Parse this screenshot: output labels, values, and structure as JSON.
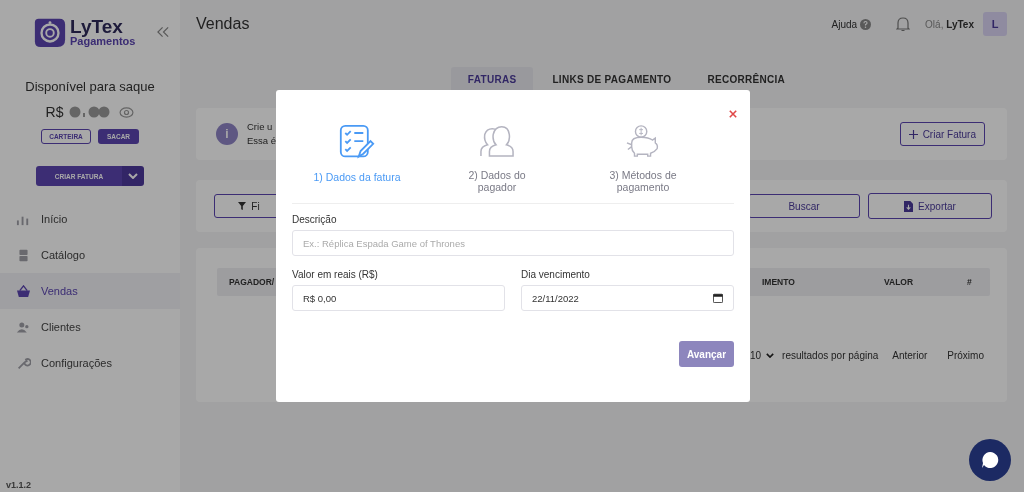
{
  "sidebar": {
    "logo": {
      "name": "LyTex",
      "subtitle": "Pagamentos"
    },
    "balance": {
      "title": "Disponível para saque",
      "currency": "R$"
    },
    "wallet_buttons": [
      "CARTEIRA",
      "SACAR"
    ],
    "create_button": "CRIAR FATURA",
    "items": [
      {
        "label": "Início",
        "kind": "chart",
        "selected": false
      },
      {
        "label": "Catálogo",
        "kind": "drawer",
        "selected": false
      },
      {
        "label": "Vendas",
        "kind": "basket",
        "selected": true
      },
      {
        "label": "Clientes",
        "kind": "users",
        "selected": false
      },
      {
        "label": "Configurações",
        "kind": "wrench",
        "selected": false
      }
    ],
    "version": "v1.1.2"
  },
  "header": {
    "title": "Vendas",
    "help": "Ajuda",
    "greeting": "Olá,",
    "user": "LyTex",
    "avatar": "L"
  },
  "tabs": [
    {
      "label": "FATURAS",
      "selected": true
    },
    {
      "label": "LINKS DE PAGAMENTO",
      "selected": false
    },
    {
      "label": "RECORRÊNCIA",
      "selected": false
    }
  ],
  "info": {
    "icon": "i",
    "lines": [
      "Crie u",
      "Essa é"
    ],
    "button": "Criar Fatura"
  },
  "filters": {
    "filter_button": "Fi",
    "search_button": "Buscar",
    "export_button": "Exportar"
  },
  "table": {
    "columns": [
      "PAGADOR/",
      "IMENTO",
      "VALOR",
      "#"
    ],
    "page_size": "10",
    "page_size_label": "resultados por página",
    "previous": "Anterior",
    "next": "Próximo"
  },
  "modal": {
    "steps": [
      {
        "label": "1) Dados da fatura",
        "kind": "checklist",
        "selected": true
      },
      {
        "label": "2) Dados do pagador",
        "kind": "users",
        "selected": false
      },
      {
        "label": "3) Métodos de pagamento",
        "kind": "piggy",
        "selected": false
      }
    ],
    "description": {
      "label": "Descrição",
      "placeholder": "Ex.: Réplica Espada Game of Thrones"
    },
    "amount": {
      "label": "Valor em reais (R$)",
      "value": "R$ 0,00"
    },
    "due_date": {
      "label": "Dia vencimento",
      "value": "22/11/2022"
    },
    "submit": "Avançar"
  }
}
